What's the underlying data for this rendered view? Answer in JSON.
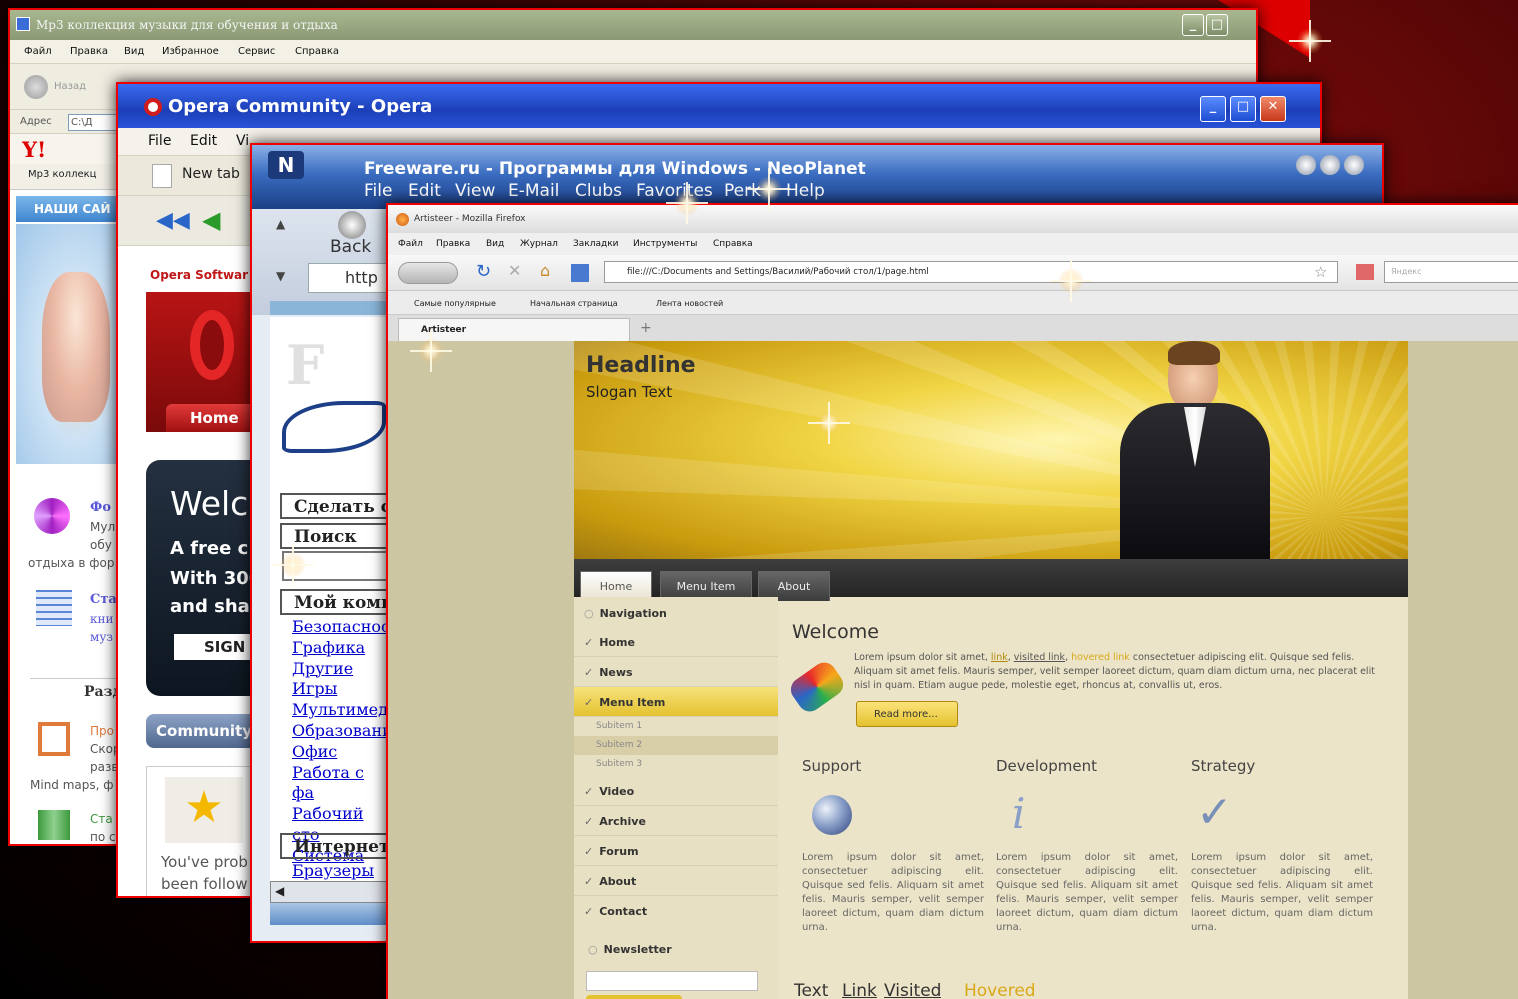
{
  "win1": {
    "title": "Mp3 коллекция музыки для обучения и отдыха",
    "menu": [
      "Файл",
      "Правка",
      "Вид",
      "Избранное",
      "Сервис",
      "Справка"
    ],
    "back": "Назад",
    "address_label": "Адрес",
    "address_value": "C:\\Д",
    "tab": "Mp3 коллекц",
    "sites_banner": "НАШИ САЙ",
    "item1_title": "Фо",
    "item1_lines": [
      "Мул",
      "обу"
    ],
    "item1_tail": "отдыха в фор",
    "item2_title": "Ста",
    "item2_lines": [
      "кни",
      "муз"
    ],
    "section": "Разд",
    "item3_title": "Про",
    "item3_lines": [
      "Скор",
      "разв"
    ],
    "item3_tail": "Mind maps, ф",
    "item4_title": "Ста",
    "item4_lines": [
      "по с"
    ]
  },
  "win2": {
    "title": "Opera Community - Opera",
    "menu": [
      "File",
      "Edit",
      "Vi"
    ],
    "newtab": "New tab",
    "software": "Opera Softwar",
    "home": "Home",
    "welcome": "Welc",
    "free": "A free c",
    "with": "With 300",
    "share": "and sha",
    "sign": "SIGN",
    "community": "Community",
    "probably": "You've prob",
    "been": "been follow"
  },
  "win3": {
    "title": "Freeware.ru - Программы для Windows - NeoPlanet",
    "menu": [
      "File",
      "Edit",
      "View",
      "E-Mail",
      "Clubs",
      "Favorites",
      "Perk",
      "Help"
    ],
    "back": "Back",
    "address": "http",
    "make": "Сделать с",
    "search": "Поиск",
    "mycomp": "Мой комп",
    "links": [
      "Безопасност",
      "Графика",
      "Другие",
      "Игры",
      "Мультимеди",
      "Образовани",
      "Офис",
      "Работа с фа",
      "Рабочий сто",
      "Система"
    ],
    "internet": "Интернет",
    "browsers": "Браузеры"
  },
  "win4": {
    "title": "Artisteer - Mozilla Firefox",
    "menu": [
      "Файл",
      "Правка",
      "Вид",
      "Журнал",
      "Закладки",
      "Инструменты",
      "Справка"
    ],
    "address": "file:///C:/Documents and Settings/Василий/Рабочий стол/1/page.html",
    "search_placeholder": "Яндекс",
    "bookmarks": [
      "Самые популярные",
      "Начальная страница",
      "Лента новостей"
    ],
    "tab": "Artisteer",
    "headline": "Headline",
    "slogan": "Slogan Text",
    "nav_tabs": [
      "Home",
      "Menu Item",
      "About"
    ],
    "nav_heading": "Navigation",
    "nav_items": [
      "Home",
      "News",
      "Menu Item"
    ],
    "sub_items": [
      "Subitem 1",
      "Subitem 2",
      "Subitem 3"
    ],
    "nav_items2": [
      "Video",
      "Archive",
      "Forum",
      "About",
      "Contact"
    ],
    "newsletter": "Newsletter",
    "welcome": "Welcome",
    "intro_pre": "Lorem ipsum dolor sit amet,",
    "intro_link": "link",
    "intro_visited": "visited link",
    "intro_hovered": "hovered link",
    "intro_post": "consectetuer adipiscing elit. Quisque sed felis. Aliquam sit amet felis. Mauris semper, velit semper laoreet dictum, quam diam dictum urna, nec placerat elit nisl in quam. Etiam augue pede, molestie eget, rhoncus at, convallis ut, eros.",
    "readmore": "Read more...",
    "columns": [
      {
        "title": "Support",
        "text": "Lorem ipsum dolor sit amet, consectetuer adipiscing elit. Quisque sed felis. Aliquam sit amet felis. Mauris semper, velit semper laoreet dictum, quam diam dictum urna."
      },
      {
        "title": "Development",
        "text": "Lorem ipsum dolor sit amet, consectetuer adipiscing elit. Quisque sed felis. Aliquam sit amet felis. Mauris semper, velit semper laoreet dictum, quam diam dictum urna."
      },
      {
        "title": "Strategy",
        "text": "Lorem ipsum dolor sit amet, consectetuer adipiscing elit. Quisque sed felis. Aliquam sit amet felis. Mauris semper, velit semper laoreet dictum, quam diam dictum urna."
      }
    ],
    "footer_text": "Text",
    "footer_link": "Link",
    "footer_visited": "Visited",
    "footer_hovered": "Hovered"
  },
  "colors": {
    "frame": "#e00000",
    "xp_blue": "#1e4ed1",
    "artisteer_gold": "#e8c220",
    "nav_dark": "#2e2e2e"
  }
}
